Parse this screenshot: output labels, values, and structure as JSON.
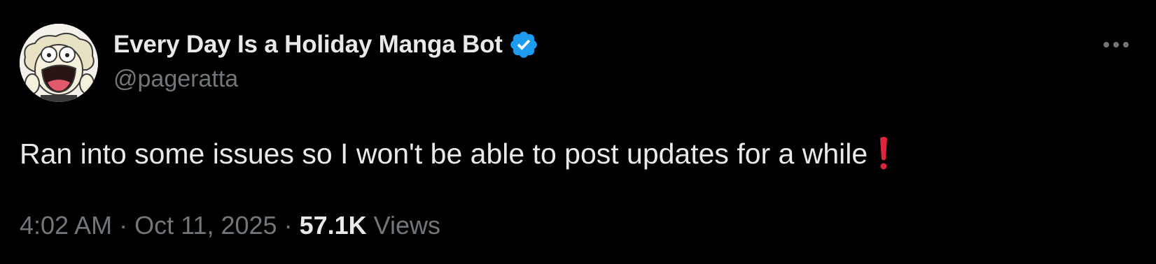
{
  "author": {
    "display_name": "Every Day Is a Holiday Manga Bot",
    "handle": "@pageratta",
    "verified": true,
    "avatar": "manga-character-shocked-face"
  },
  "tweet": {
    "text": "Ran into some issues so I won't be able to post updates for a while",
    "emoji": "red-exclamation-mark"
  },
  "meta": {
    "time": "4:02 AM",
    "separator": "·",
    "date": "Oct 11, 2025",
    "views_count": "57.1K",
    "views_label": "Views"
  },
  "icons": {
    "more": "more-horizontal-icon",
    "verified": "verified-badge-icon"
  },
  "colors": {
    "background": "#000000",
    "primary_text": "#e7e9ea",
    "secondary_text": "#71767b",
    "verified_blue": "#1d9bf0",
    "emoji_red": "#e0243b"
  }
}
